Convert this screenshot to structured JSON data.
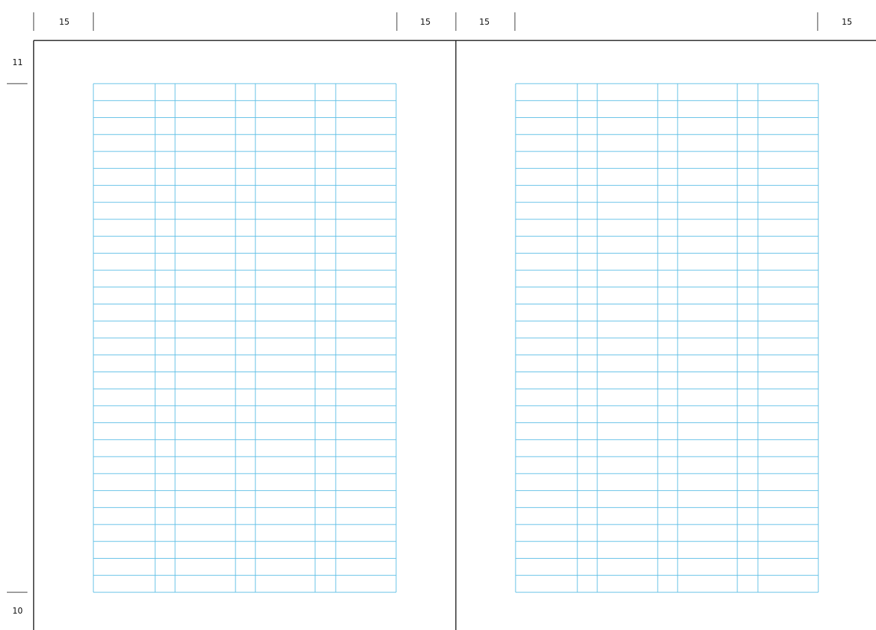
{
  "margins": {
    "top_left_page_left": "15",
    "top_left_page_right": "15",
    "top_right_page_left": "15",
    "top_right_page_right": "15",
    "left_top": "11",
    "left_bottom": "10"
  },
  "pages": [
    {
      "name": "left-page",
      "row_count": 30
    },
    {
      "name": "right-page",
      "row_count": 30
    }
  ],
  "colors": {
    "grid": "#5fbfe6",
    "frame": "#222222",
    "page": "#ffffff"
  }
}
